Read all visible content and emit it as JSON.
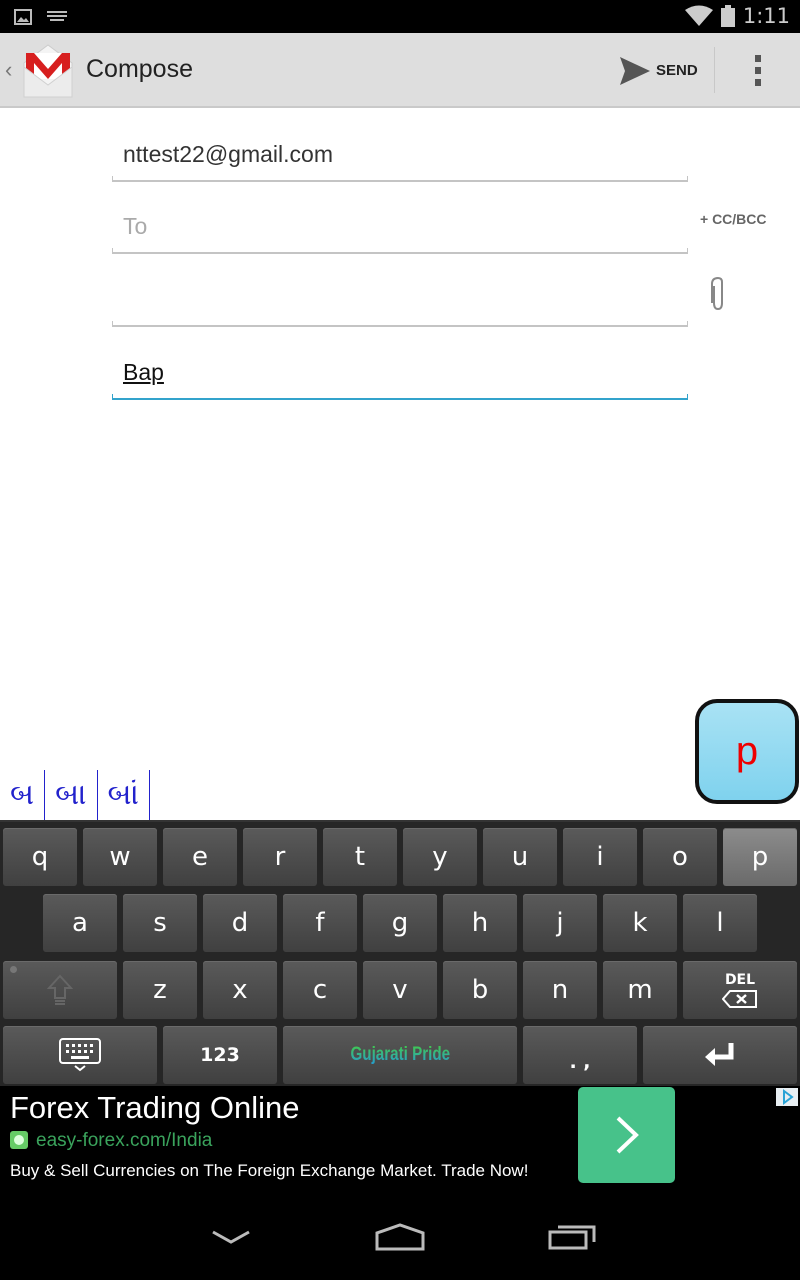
{
  "status_bar": {
    "time": "1:11",
    "icons": [
      "image-icon",
      "keyboard-icon",
      "wifi-icon",
      "battery-icon"
    ]
  },
  "action_bar": {
    "title": "Compose",
    "send_label": "SEND"
  },
  "compose": {
    "from": "nttest22@gmail.com",
    "to_placeholder": "To",
    "to_value": "",
    "cc_bcc_label": "+ CC/BCC",
    "subject_value": "",
    "body_value": "Bap"
  },
  "ime": {
    "floating_preview": "p",
    "candidates": [
      "બ",
      "બા",
      "બાં"
    ],
    "rows": [
      [
        "q",
        "w",
        "e",
        "r",
        "t",
        "y",
        "u",
        "i",
        "o",
        "p"
      ],
      [
        "a",
        "s",
        "d",
        "f",
        "g",
        "h",
        "j",
        "k",
        "l"
      ],
      [
        "z",
        "x",
        "c",
        "v",
        "b",
        "n",
        "m"
      ]
    ],
    "del_label": "DEL",
    "numbers_label": "123",
    "space_label": "Gujarati Pride",
    "punct_label": ". ,",
    "pressed_key": "p"
  },
  "ad": {
    "title": "Forex Trading Online",
    "url": "easy-forex.com/India",
    "description": "Buy & Sell Currencies on The Foreign Exchange Market. Trade Now!",
    "brand_color": "#47c28a"
  }
}
